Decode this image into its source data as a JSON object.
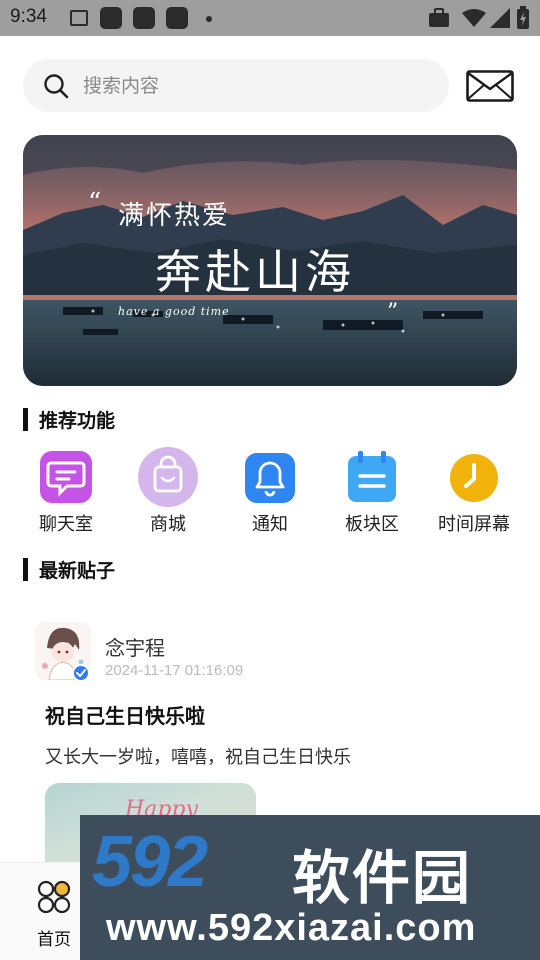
{
  "status_bar": {
    "time": "9:34"
  },
  "search": {
    "placeholder": "搜索内容"
  },
  "banner": {
    "headline_small": "满怀热爱",
    "headline_big": "奔赴山海",
    "script_text": "have a good time",
    "open_quote": "“",
    "close_quote": "”"
  },
  "sections": {
    "recommended": "推荐功能",
    "latest_posts": "最新贴子"
  },
  "features": [
    {
      "label": "聊天室",
      "icon": "chat-icon",
      "color": "#c554e6"
    },
    {
      "label": "商城",
      "icon": "shopping-bag-icon",
      "color": "#d4b6ec"
    },
    {
      "label": "通知",
      "icon": "bell-icon",
      "color": "#2f86f0"
    },
    {
      "label": "板块区",
      "icon": "board-icon",
      "color": "#3ea8f5"
    },
    {
      "label": "时间屏幕",
      "icon": "clock-icon",
      "color": "#f2b20c"
    }
  ],
  "post": {
    "author": "念宇程",
    "timestamp": "2024-11-17 01:16:09",
    "title": "祝自己生日快乐啦",
    "body": "又长大一岁啦，嘻嘻，祝自己生日快乐",
    "image_text": "Happy Birthday"
  },
  "bottom_nav": {
    "home_label": "首页",
    "home_icon": "home-grid-icon"
  },
  "watermark": {
    "logo": "592",
    "name": "软件园",
    "url": "www.592xiazai.com"
  },
  "colors": {
    "accent": "#2f86f0",
    "banner_sky": "#c9786e",
    "banner_sea": "#2c3e4c"
  }
}
